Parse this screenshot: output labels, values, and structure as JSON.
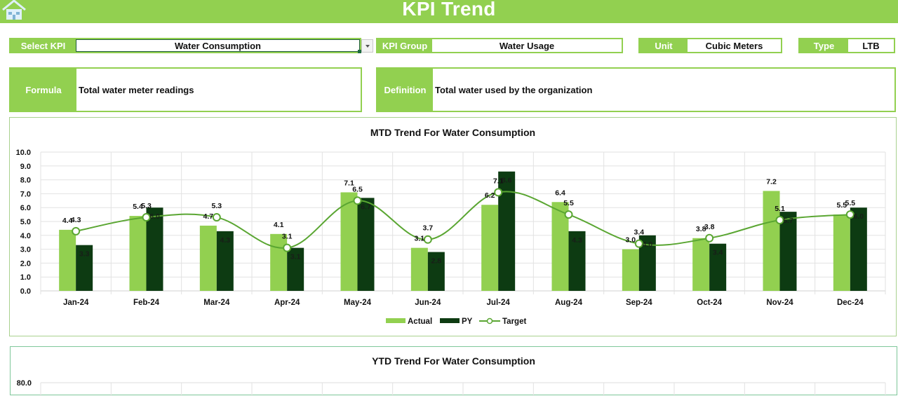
{
  "header": {
    "title": "KPI Trend",
    "home_icon": "home-icon"
  },
  "filters": {
    "select_kpi": {
      "label": "Select KPI",
      "value": "Water Consumption"
    },
    "kpi_group": {
      "label": "KPI Group",
      "value": "Water Usage"
    },
    "unit": {
      "label": "Unit",
      "value": "Cubic Meters"
    },
    "type": {
      "label": "Type",
      "value": "LTB"
    }
  },
  "info": {
    "formula": {
      "label": "Formula",
      "value": "Total water meter readings"
    },
    "definition": {
      "label": "Definition",
      "value": "Total water used by the organization"
    }
  },
  "colors": {
    "accent": "#92d050",
    "actual": "#92d050",
    "py": "#0d3b12",
    "target": "#5aa632"
  },
  "chart_data": [
    {
      "type": "bar",
      "title": "MTD Trend For Water Consumption",
      "xlabel": "",
      "ylabel": "",
      "ylim": [
        0,
        10
      ],
      "yticks": [
        "0.0",
        "1.0",
        "2.0",
        "3.0",
        "4.0",
        "5.0",
        "6.0",
        "7.0",
        "8.0",
        "9.0",
        "10.0"
      ],
      "grid": true,
      "legend": "bottom",
      "categories": [
        "Jan-24",
        "Feb-24",
        "Mar-24",
        "Apr-24",
        "May-24",
        "Jun-24",
        "Jul-24",
        "Aug-24",
        "Sep-24",
        "Oct-24",
        "Nov-24",
        "Dec-24"
      ],
      "series": [
        {
          "name": "Actual",
          "kind": "bar",
          "values": [
            4.4,
            5.4,
            4.7,
            4.1,
            7.1,
            3.1,
            6.2,
            6.4,
            3.0,
            3.8,
            7.2,
            5.5
          ]
        },
        {
          "name": "PY",
          "kind": "bar",
          "values": [
            3.3,
            6.0,
            4.3,
            3.1,
            6.7,
            2.8,
            8.6,
            4.3,
            4.0,
            3.4,
            5.7,
            6.0
          ]
        },
        {
          "name": "Target",
          "kind": "line",
          "values": [
            4.3,
            5.3,
            5.3,
            3.1,
            6.5,
            3.7,
            7.1,
            5.5,
            3.4,
            3.8,
            5.1,
            5.5
          ]
        }
      ]
    },
    {
      "type": "bar",
      "title": "YTD Trend For Water Consumption",
      "yticks_visible": [
        "80.0"
      ]
    }
  ]
}
